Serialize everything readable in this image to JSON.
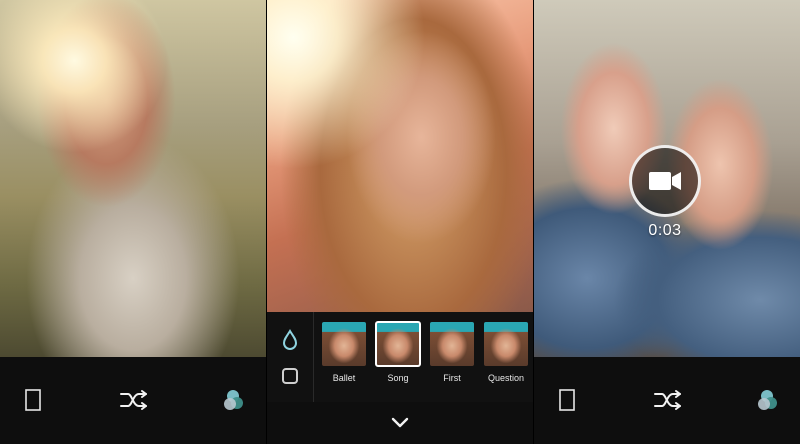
{
  "panels": [
    {
      "id": "panel-1",
      "bottom_bar": {
        "icons": [
          "frame-icon",
          "shuffle-icon",
          "color-circles-icon"
        ]
      }
    },
    {
      "id": "panel-2",
      "filter_tools": [
        "water-drop-icon",
        "square-icon"
      ],
      "filters": [
        {
          "label": "Ballet",
          "selected": false
        },
        {
          "label": "Song",
          "selected": true
        },
        {
          "label": "First",
          "selected": false
        },
        {
          "label": "Question",
          "selected": false
        }
      ],
      "bottom_control": {
        "icon": "chevron-down-icon"
      }
    },
    {
      "id": "panel-3",
      "record": {
        "icon": "video-camera-icon",
        "timer": "0:03"
      },
      "bottom_bar": {
        "icons": [
          "frame-icon",
          "shuffle-icon",
          "color-circles-icon"
        ]
      }
    }
  ],
  "colors": {
    "bar_background": "#0e0e0e",
    "accent_filter_drop": "#8fd3e0",
    "color_icon_1": "#7fc6cf",
    "color_icon_2": "#3f8f8a",
    "color_icon_3": "#b7c8cf"
  }
}
